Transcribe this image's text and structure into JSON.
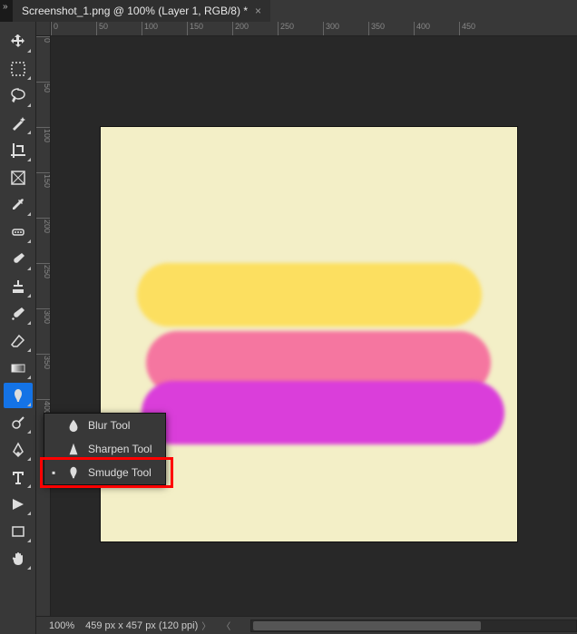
{
  "tab": {
    "title": "Screenshot_1.png @ 100% (Layer 1, RGB/8) *",
    "close_label": "×"
  },
  "expand_glyph": "»",
  "ruler_h": [
    "0",
    "50",
    "100",
    "150",
    "200",
    "250",
    "300",
    "350",
    "400",
    "450"
  ],
  "ruler_v": [
    "0",
    "50",
    "100",
    "150",
    "200",
    "250",
    "300",
    "350",
    "400"
  ],
  "tools": [
    {
      "name": "move-tool",
      "fly": true
    },
    {
      "name": "marquee-tool",
      "fly": true
    },
    {
      "name": "lasso-tool",
      "fly": true
    },
    {
      "name": "magic-wand-tool",
      "fly": true
    },
    {
      "name": "crop-tool",
      "fly": true
    },
    {
      "name": "frame-tool",
      "fly": false
    },
    {
      "name": "eyedropper-tool",
      "fly": true
    },
    {
      "name": "healing-brush-tool",
      "fly": true
    },
    {
      "name": "brush-tool",
      "fly": true
    },
    {
      "name": "clone-stamp-tool",
      "fly": true
    },
    {
      "name": "history-brush-tool",
      "fly": true
    },
    {
      "name": "eraser-tool",
      "fly": true
    },
    {
      "name": "gradient-tool",
      "fly": true
    },
    {
      "name": "smudge-tool",
      "fly": true,
      "selected": true
    },
    {
      "name": "dodge-tool",
      "fly": true
    },
    {
      "name": "pen-tool",
      "fly": true
    },
    {
      "name": "type-tool",
      "fly": true
    },
    {
      "name": "path-selection-tool",
      "fly": true
    },
    {
      "name": "rectangle-tool",
      "fly": true
    },
    {
      "name": "hand-tool",
      "fly": true
    }
  ],
  "flyout": {
    "items": [
      {
        "label": "Blur Tool",
        "active": false
      },
      {
        "label": "Sharpen Tool",
        "active": false
      },
      {
        "label": "Smudge Tool",
        "active": true
      }
    ]
  },
  "canvas": {
    "bg_color": "#f3efc7",
    "strokes": [
      {
        "color": "yellow",
        "hex": "#fcdf60"
      },
      {
        "color": "pink",
        "hex": "#f576a0"
      },
      {
        "color": "magenta",
        "hex": "#da3eda"
      }
    ]
  },
  "status": {
    "zoom": "100%",
    "doc_info": "459 px x 457 px (120 ppi)"
  }
}
